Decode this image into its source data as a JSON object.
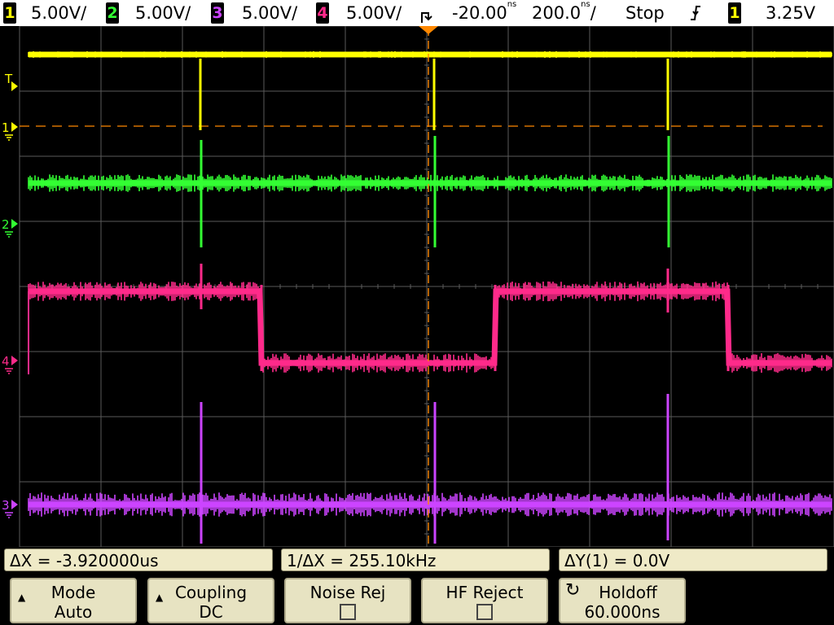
{
  "topbar": {
    "channels": [
      {
        "num": "1",
        "scale": "5.00V/",
        "color": "#ffff00"
      },
      {
        "num": "2",
        "scale": "5.00V/",
        "color": "#33ff33"
      },
      {
        "num": "3",
        "scale": "5.00V/",
        "color": "#cc44ff"
      },
      {
        "num": "4",
        "scale": "5.00V/",
        "color": "#ff2a8a"
      }
    ],
    "delay": "-20.00",
    "delay_unit": "ns",
    "timebase": "200.0",
    "timebase_unit": "ns",
    "timebase_suffix": "/",
    "run_state": "Stop",
    "trigger_edge_icon": "falling-edge-icon",
    "trigger_source": "1",
    "trigger_level": "3.25V"
  },
  "screen": {
    "channel_markers": [
      {
        "label": "T",
        "icon": "trigger-level-marker-icon",
        "color": "#ffff00"
      },
      {
        "label": "1",
        "icon": "ground-icon",
        "color": "#ffff00"
      },
      {
        "label": "2",
        "icon": "ground-icon",
        "color": "#33ff33"
      },
      {
        "label": "4",
        "icon": "ground-icon",
        "color": "#ff2a8a"
      },
      {
        "label": "3",
        "icon": "ground-icon",
        "color": "#cc44ff"
      }
    ],
    "trigger_marker_color": "#ff8800"
  },
  "readouts": {
    "delta_x": "ΔX = -3.920000us",
    "inv_delta_x": "1/ΔX = 255.10kHz",
    "delta_y": "ΔY(1) = 0.0V"
  },
  "softkeys": {
    "mode": {
      "label": "Mode",
      "value": "Auto"
    },
    "coupling": {
      "label": "Coupling",
      "value": "DC"
    },
    "noise_rej": {
      "label": "Noise Rej"
    },
    "hf_reject": {
      "label": "HF Reject"
    },
    "holdoff": {
      "label": "Holdoff",
      "value": "60.000ns"
    }
  }
}
